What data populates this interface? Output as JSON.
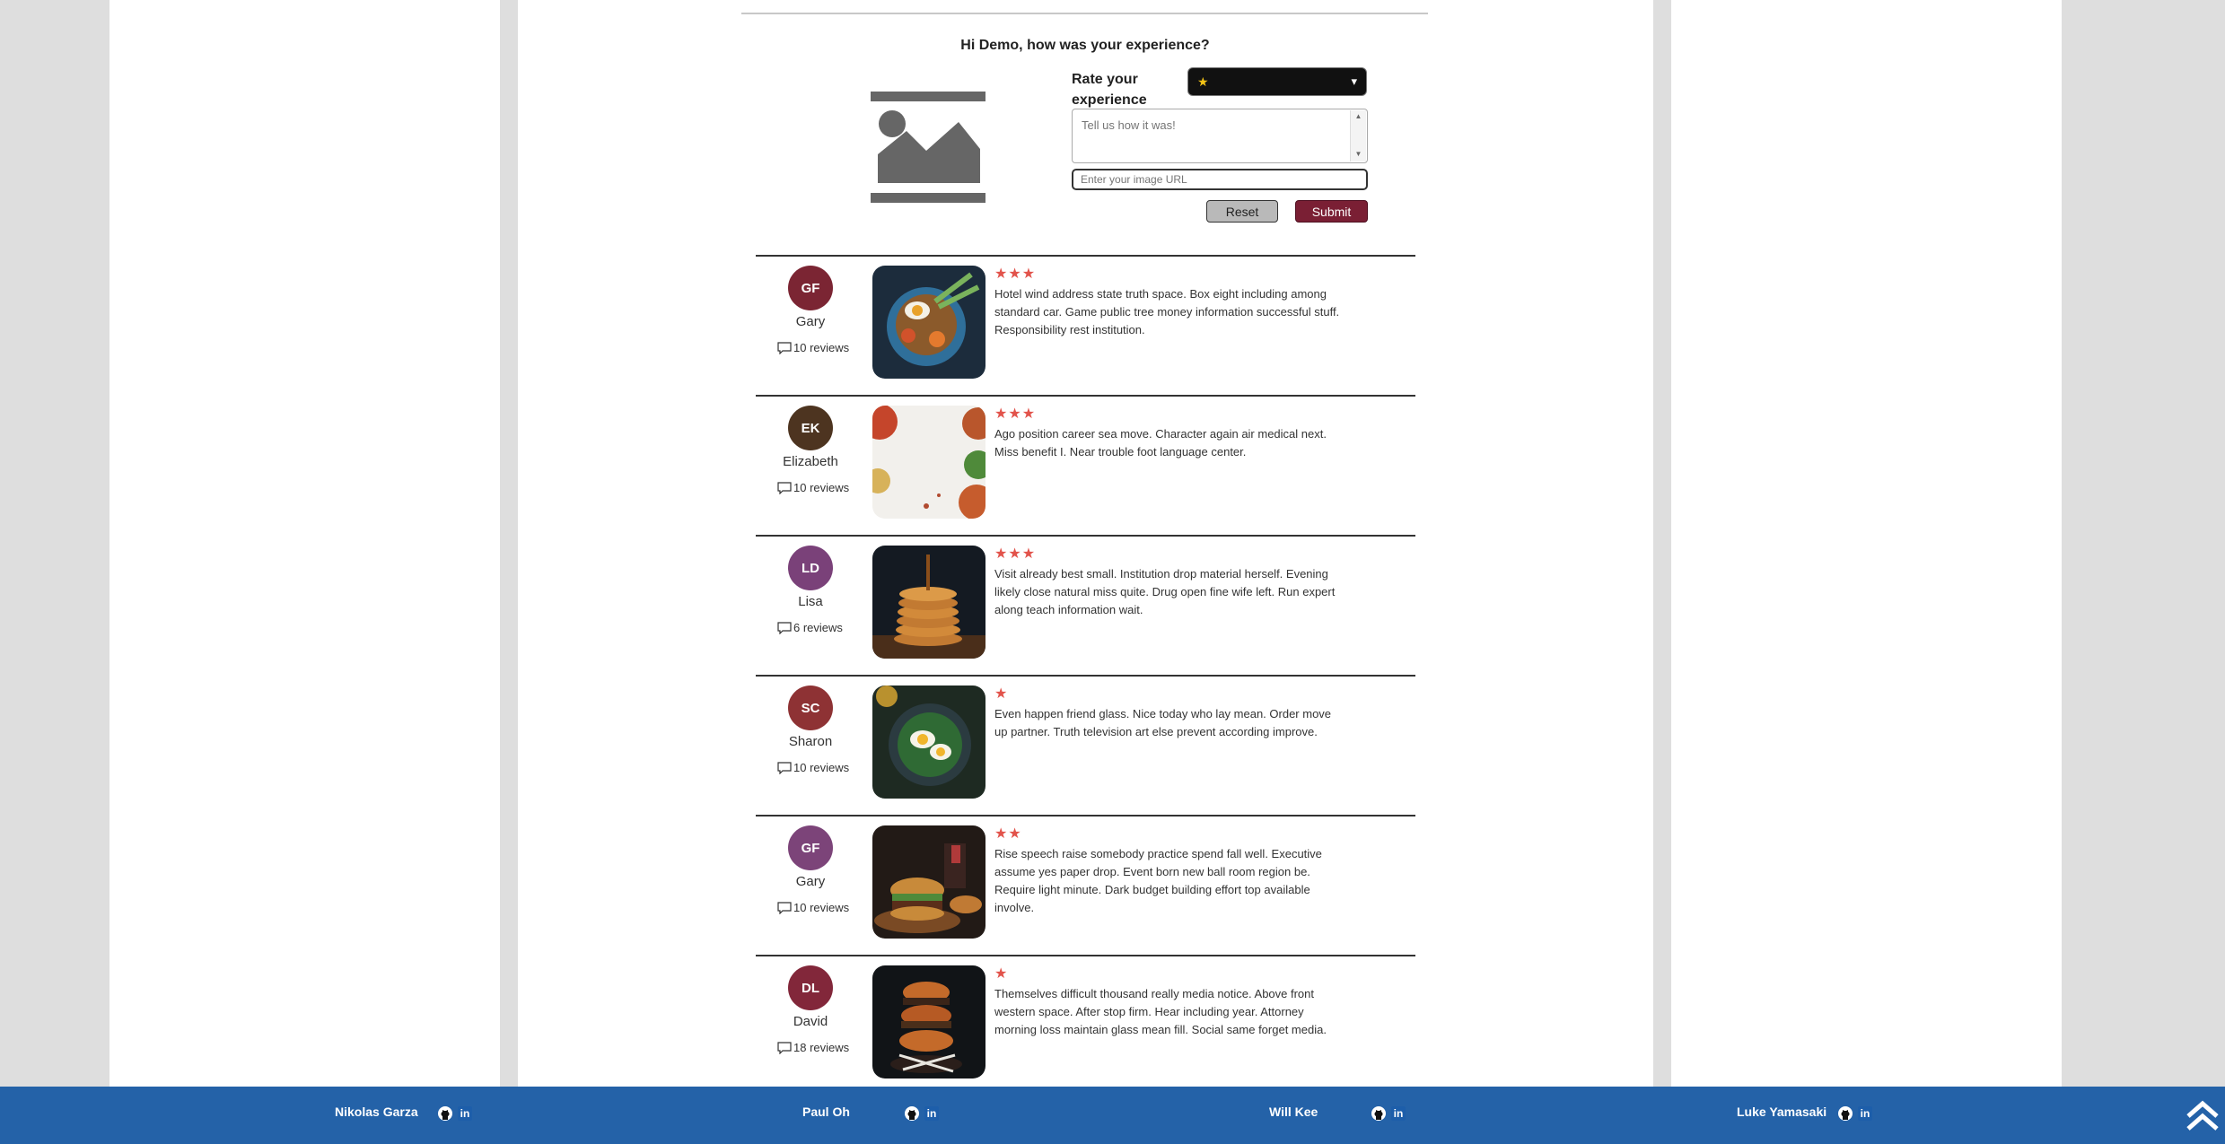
{
  "form": {
    "greeting": "Hi Demo, how was your experience?",
    "rate_label": "Rate your experience",
    "rating_selected": "★",
    "review_placeholder": "Tell us how it was!",
    "url_placeholder": "Enter your image URL",
    "reset_label": "Reset",
    "submit_label": "Submit"
  },
  "reviews": [
    {
      "initials": "GF",
      "name": "Gary",
      "count": "10 reviews",
      "avatar_color": "#7b2533",
      "stars": "★★★",
      "rating": 3,
      "text": "Hotel wind address state truth space. Box eight including among standard car. Game public tree money information successful stuff. Responsibility rest institution."
    },
    {
      "initials": "EK",
      "name": "Elizabeth",
      "count": "10 reviews",
      "avatar_color": "#4d3420",
      "stars": "★★★",
      "rating": 3,
      "text": "Ago position career sea move. Character again air medical next. Miss benefit I. Near trouble foot language center."
    },
    {
      "initials": "LD",
      "name": "Lisa",
      "count": "6 reviews",
      "avatar_color": "#7a4179",
      "stars": "★★★",
      "rating": 3,
      "text": "Visit already best small. Institution drop material herself. Evening likely close natural miss quite. Drug open fine wife left. Run expert along teach information wait."
    },
    {
      "initials": "SC",
      "name": "Sharon",
      "count": "10 reviews",
      "avatar_color": "#8e3234",
      "stars": "★",
      "rating": 1,
      "text": "Even happen friend glass. Nice today who lay mean. Order move up partner. Truth television art else prevent according improve."
    },
    {
      "initials": "GF",
      "name": "Gary",
      "count": "10 reviews",
      "avatar_color": "#7c4479",
      "stars": "★★",
      "rating": 2,
      "text": "Rise speech raise somebody practice spend fall well. Executive assume yes paper drop. Event born new ball room region be. Require light minute. Dark budget building effort top available involve."
    },
    {
      "initials": "DL",
      "name": "David",
      "count": "18 reviews",
      "avatar_color": "#82273a",
      "stars": "★",
      "rating": 1,
      "text": "Themselves difficult thousand really media notice. Above front western space. After stop firm. Hear including year. Attorney morning loss maintain glass mean fill. Social same forget media."
    }
  ],
  "footer": {
    "members": [
      {
        "name": "Nikolas Garza"
      },
      {
        "name": "Paul Oh"
      },
      {
        "name": "Will Kee"
      },
      {
        "name": "Luke Yamasaki"
      }
    ],
    "linkedin_glyph": "in",
    "back_to_top_icon": "double-chevron-up-icon"
  }
}
